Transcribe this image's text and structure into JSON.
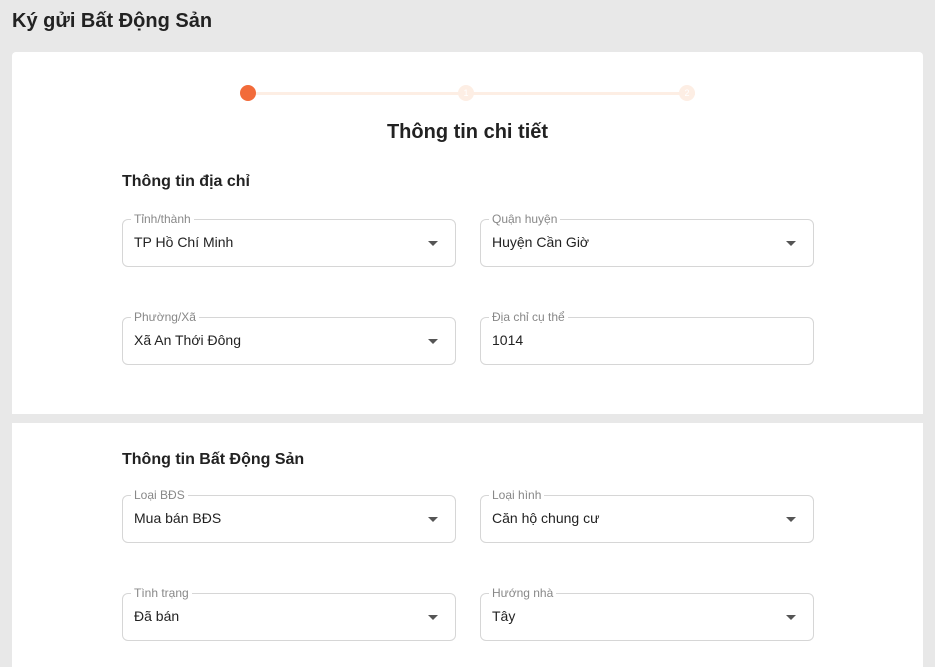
{
  "page": {
    "title": "Ký gửi Bất Động Sản"
  },
  "stepper": {
    "steps": [
      "",
      "1",
      "2"
    ],
    "active_index": 0,
    "accent": "#f26b3a"
  },
  "form": {
    "title": "Thông tin chi tiết"
  },
  "address": {
    "section_title": "Thông tin địa chỉ",
    "province": {
      "label": "Tỉnh/thành",
      "value": "TP Hồ Chí Minh"
    },
    "district": {
      "label": "Quận huyện",
      "value": "Huyện Cần Giờ"
    },
    "ward": {
      "label": "Phường/Xã",
      "value": "Xã An Thới Đông"
    },
    "street": {
      "label": "Địa chỉ cụ thể",
      "value": "1014"
    }
  },
  "property": {
    "section_title": "Thông tin Bất Động Sản",
    "category": {
      "label": "Loại BĐS",
      "value": "Mua bán BĐS"
    },
    "type": {
      "label": "Loại hình",
      "value": "Căn hộ chung cư"
    },
    "status": {
      "label": "Tình trạng",
      "value": "Đã bán"
    },
    "direction": {
      "label": "Hướng nhà",
      "value": "Tây"
    }
  }
}
